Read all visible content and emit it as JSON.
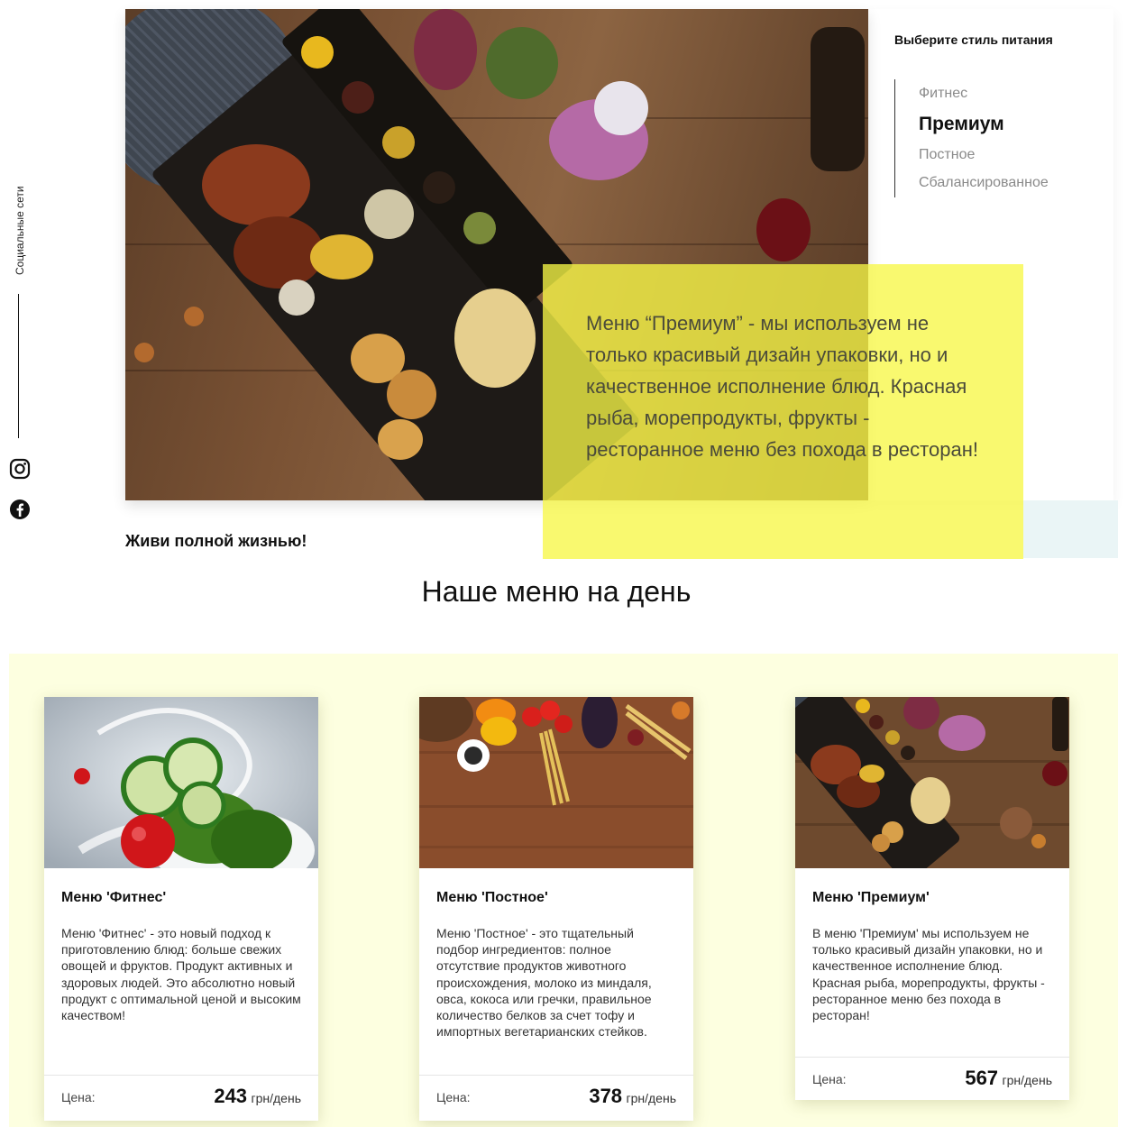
{
  "social": {
    "label": "Социальные сети",
    "icons": [
      "instagram-icon",
      "facebook-icon"
    ]
  },
  "hero": {
    "side_title": "Выберите стиль питания",
    "styles": [
      {
        "label": "Фитнес",
        "active": false
      },
      {
        "label": "Премиум",
        "active": true
      },
      {
        "label": "Постное",
        "active": false
      },
      {
        "label": "Сбалансированное",
        "active": false
      }
    ],
    "description": "Меню “Премиум” - мы используем не только красивый дизайн упаковки, но и качественное исполнение блюд. Красная рыба, морепродукты, фрукты - ресторанное меню без похода в ресторан!",
    "slogan": "Живи полной жизнью!",
    "accent_color": "#f7f746"
  },
  "menu": {
    "title": "Наше меню на день",
    "background_color": "#fdffe0",
    "cards": [
      {
        "title": "Меню 'Фитнес'",
        "description": "Меню 'Фитнес' - это новый подход к приготовлению блюд: больше свежих овощей и фруктов. Продукт активных и здоровых людей. Это абсолютно новый продукт с оптимальной ценой и высоким качеством!",
        "price_label": "Цена:",
        "price": "243",
        "price_unit": "грн/день"
      },
      {
        "title": "Меню 'Постное'",
        "description": "Меню 'Постное' - это тщательный подбор ингредиентов: полное отсутствие продуктов животного происхождения, молоко из миндаля, овса, кокоса или гречки, правильное количество белков за счет тофу и импортных вегетарианских стейков.",
        "price_label": "Цена:",
        "price": "378",
        "price_unit": "грн/день"
      },
      {
        "title": "Меню 'Премиум'",
        "description": "В меню 'Премиум' мы используем не только красивый дизайн упаковки, но и качественное исполнение блюд. Красная рыба, морепродукты, фрукты - ресторанное меню без похода в ресторан!",
        "price_label": "Цена:",
        "price": "567",
        "price_unit": "грн/день"
      }
    ]
  }
}
